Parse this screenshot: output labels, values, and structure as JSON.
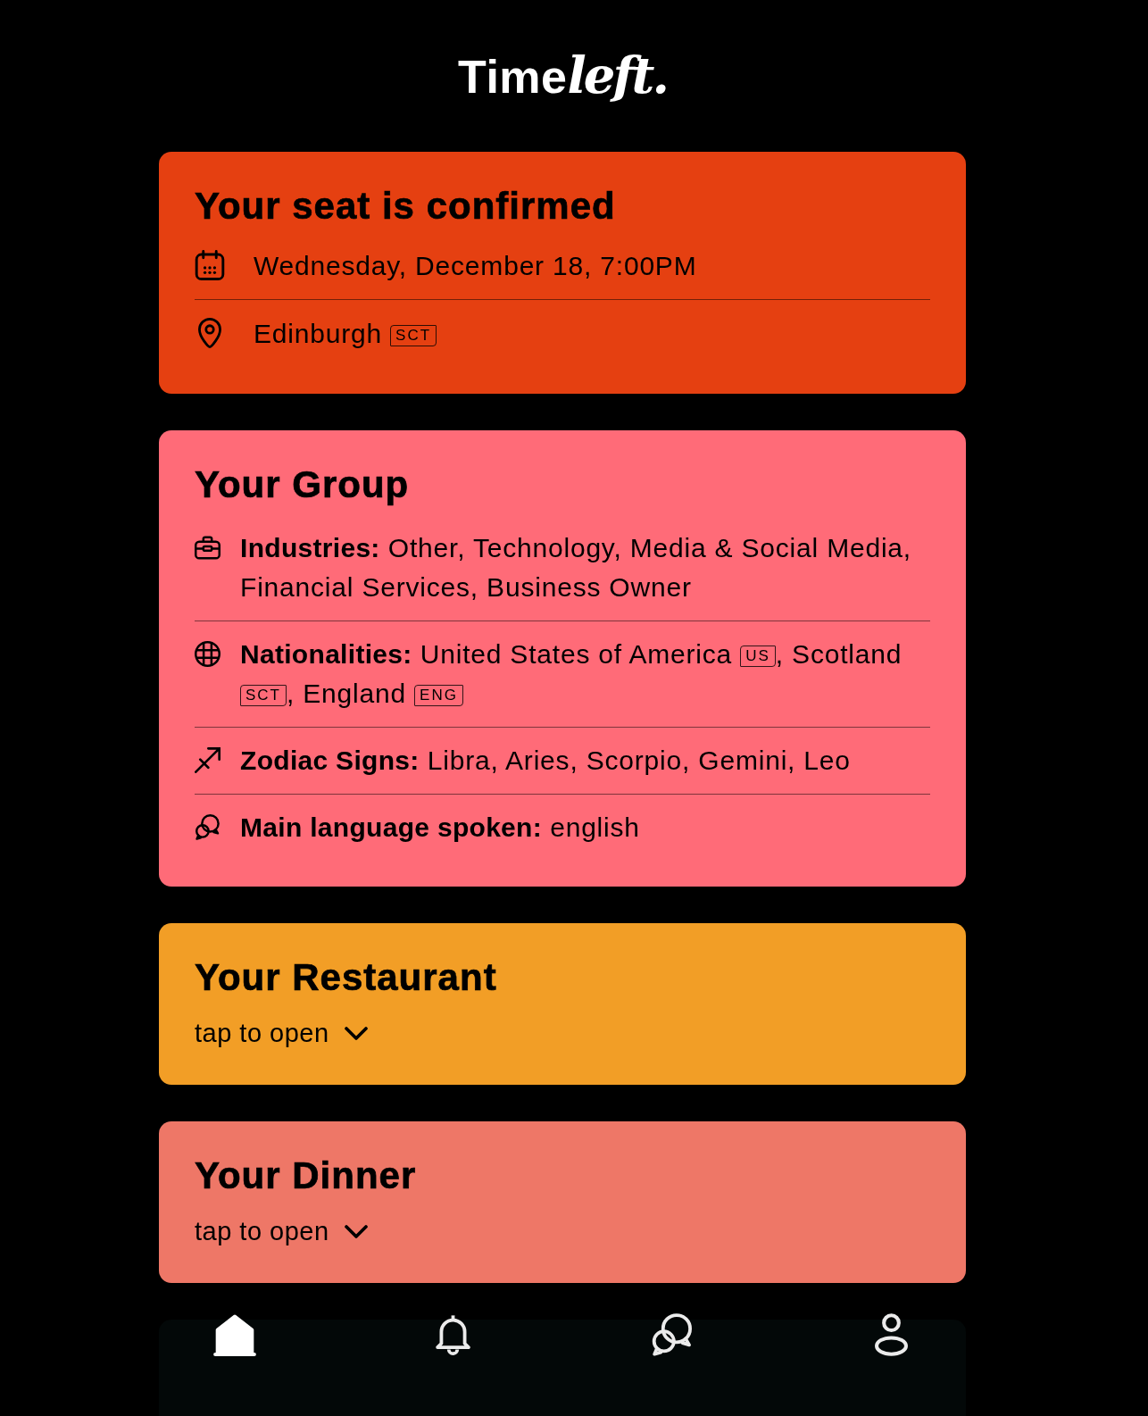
{
  "logo": {
    "parts": [
      "Time",
      "left."
    ]
  },
  "cards": [
    {
      "kind": "seat",
      "color": "#e54011",
      "title": "Your seat is confirmed",
      "rows": [
        {
          "kind": "date",
          "parts": [
            {
              "kind": "text",
              "text": "Wednesday, December 18, 7:00PM"
            }
          ]
        },
        {
          "kind": "place",
          "parts": [
            {
              "kind": "text",
              "text": "Edinburgh "
            },
            {
              "kind": "flag",
              "text": "SCT"
            }
          ]
        }
      ]
    },
    {
      "kind": "group",
      "color": "#ff6b78",
      "title": "Your Group",
      "rows": [
        {
          "kind": "industries",
          "label": "Industries:",
          "parts": [
            {
              "kind": "text",
              "text": "Other, Technology, Media & Social Media, Financial Services, Business Owner"
            }
          ]
        },
        {
          "kind": "nationalities",
          "label": "Nationalities:",
          "parts": [
            {
              "kind": "text",
              "text": "United States of America "
            },
            {
              "kind": "flag",
              "text": "US"
            },
            {
              "kind": "text",
              "text": ", Scotland "
            },
            {
              "kind": "flag",
              "text": "SCT"
            },
            {
              "kind": "text",
              "text": ", England "
            },
            {
              "kind": "flag",
              "text": "ENG"
            }
          ]
        },
        {
          "kind": "zodiac",
          "label": "Zodiac Signs:",
          "parts": [
            {
              "kind": "text",
              "text": "Libra, Aries, Scorpio, Gemini, Leo"
            }
          ]
        },
        {
          "kind": "language",
          "label": "Main language spoken:",
          "parts": [
            {
              "kind": "text",
              "text": "english"
            }
          ]
        }
      ]
    },
    {
      "kind": "collapsible",
      "color": "#f29e26",
      "title": "Your Restaurant",
      "hint": "tap to open",
      "expanded": false
    },
    {
      "kind": "collapsible",
      "color": "#ee7767",
      "title": "Your Dinner",
      "hint": "tap to open",
      "expanded": false
    },
    {
      "kind": "partial",
      "color": "#030808"
    }
  ],
  "bottom_nav": [
    {
      "kind": "home",
      "selected": true
    },
    {
      "kind": "notifications",
      "selected": false
    },
    {
      "kind": "messages",
      "selected": false
    },
    {
      "kind": "profile",
      "selected": false
    }
  ]
}
